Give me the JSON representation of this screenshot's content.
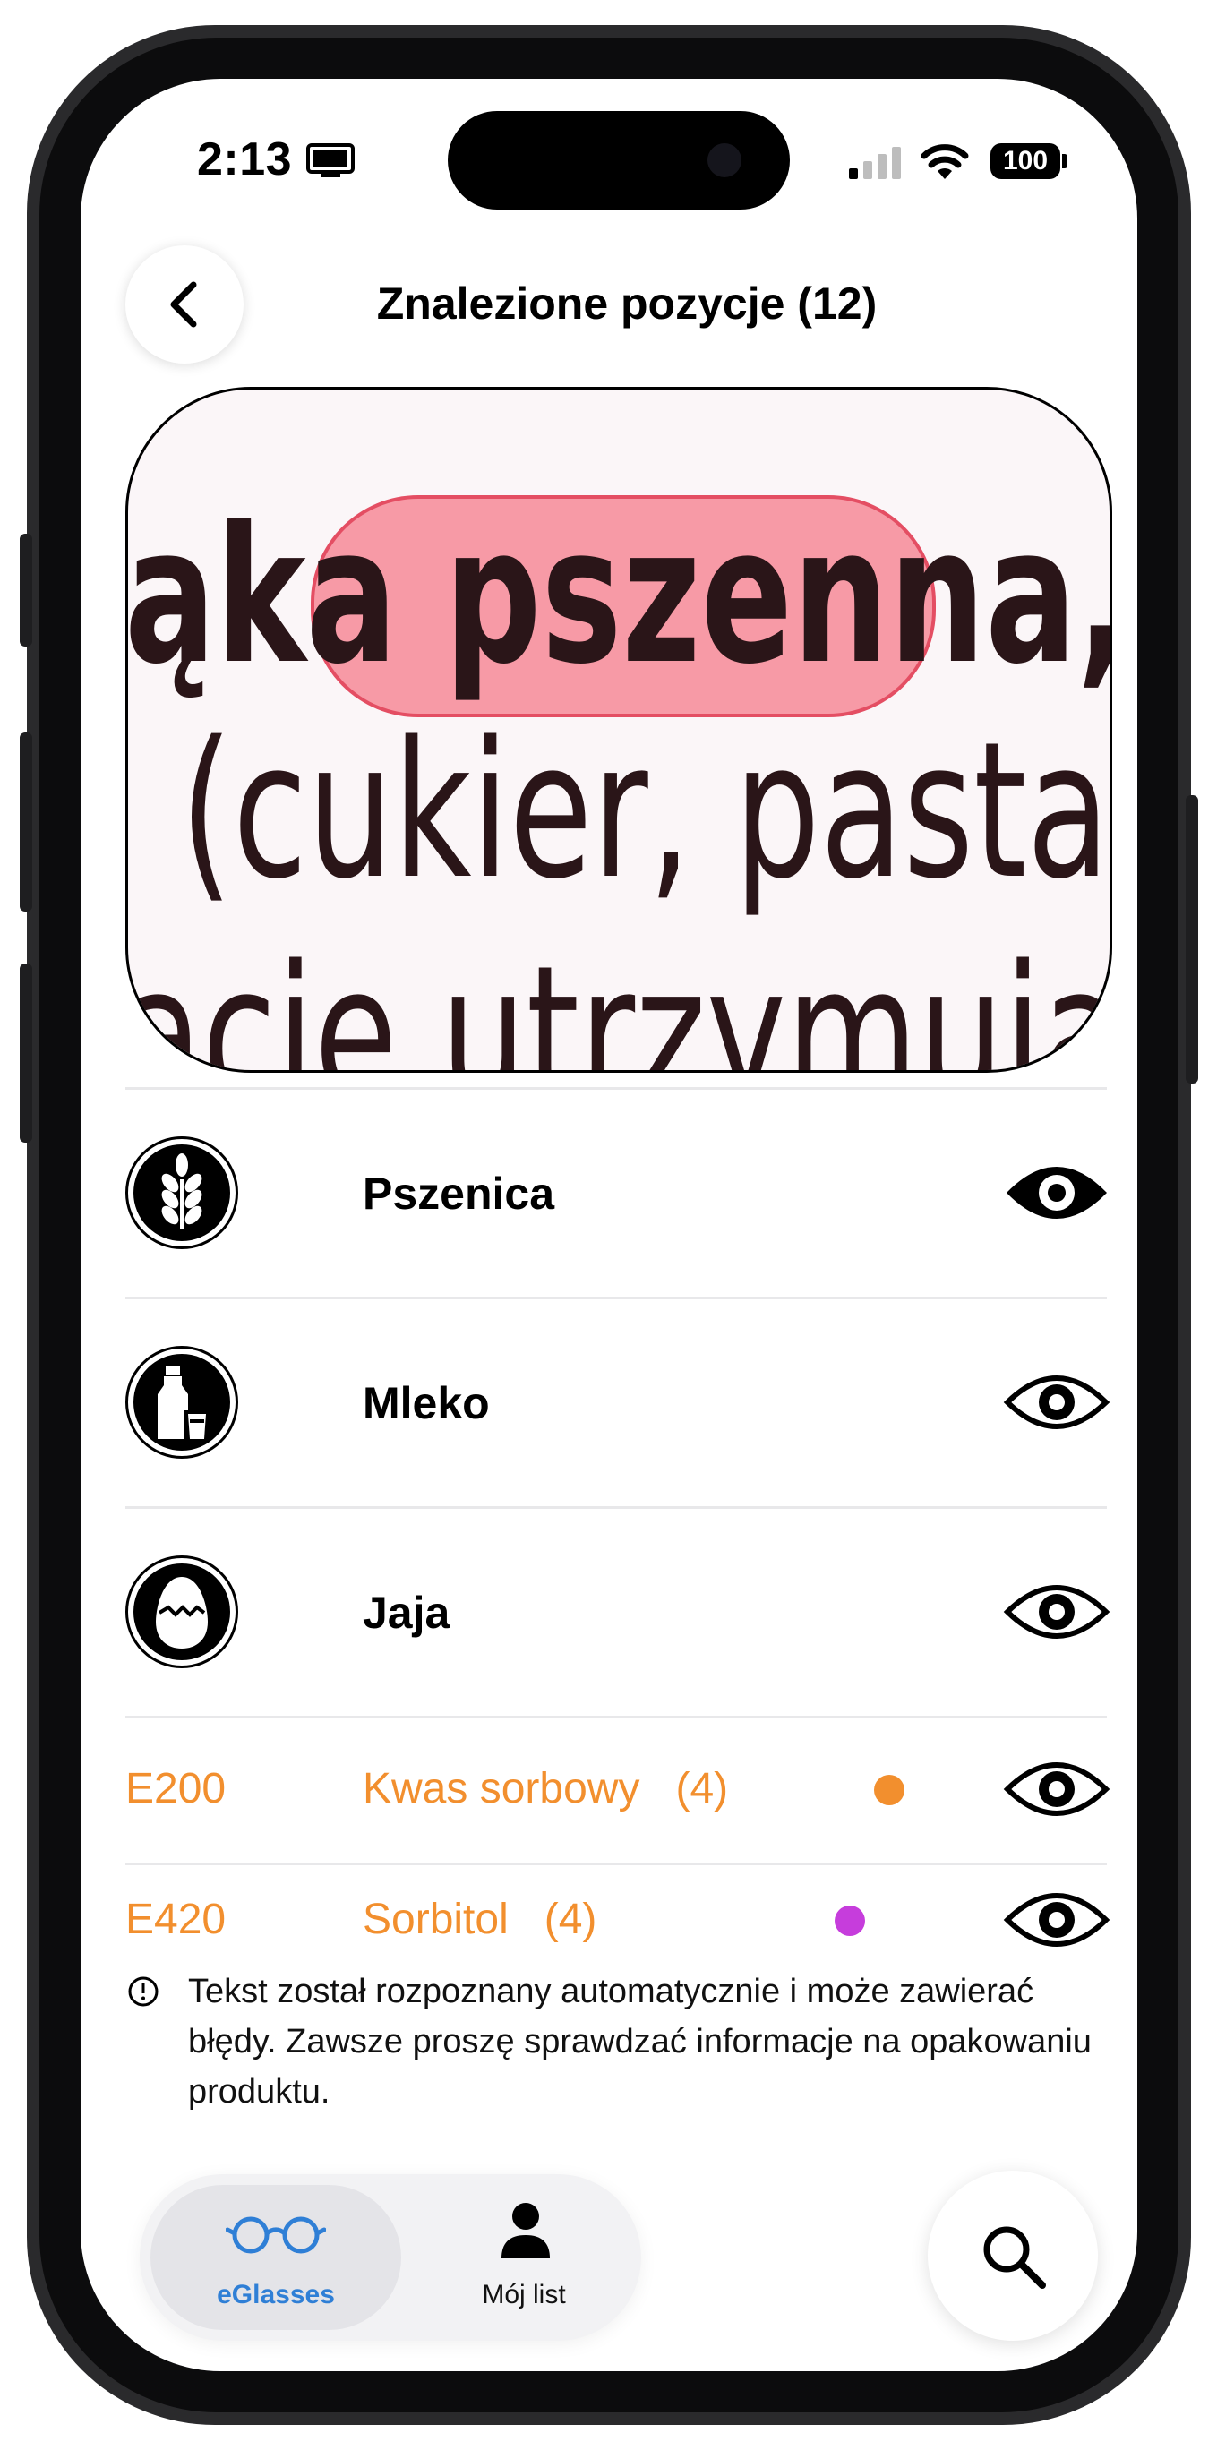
{
  "status_bar": {
    "time": "2:13",
    "battery": "100"
  },
  "header": {
    "title": "Znalezione pozycje (12)"
  },
  "scan": {
    "line1_before": "ąka ",
    "line1_highlight": "pszenna",
    "line1_after": ", cu",
    "line2": "(cukier, pasta ka",
    "line3": "acie utrzymując"
  },
  "allergens": [
    {
      "label": "Pszenica",
      "icon": "wheat-icon"
    },
    {
      "label": "Mleko",
      "icon": "milk-bottle-icon"
    },
    {
      "label": "Jaja",
      "icon": "egg-icon"
    }
  ],
  "additives": [
    {
      "code": "E200",
      "name": "Kwas sorbowy",
      "count": "(4)",
      "dot_color": "#f28f2e"
    },
    {
      "code": "E420",
      "name": "Sorbitol",
      "count": "(4)",
      "dot_color": "#c63ddc"
    }
  ],
  "note": "Tekst został rozpoznany automatycznie i może zawierać błędy. Zawsze proszę sprawdzać informacje na opakowaniu produktu.",
  "tabs": [
    {
      "label": "eGlasses",
      "icon": "glasses-icon",
      "active": true
    },
    {
      "label": "Mój list",
      "icon": "person-icon",
      "active": false
    }
  ],
  "colors": {
    "accent": "#2f7fd6",
    "orange": "#f28f2e",
    "highlight": "#f46174"
  }
}
